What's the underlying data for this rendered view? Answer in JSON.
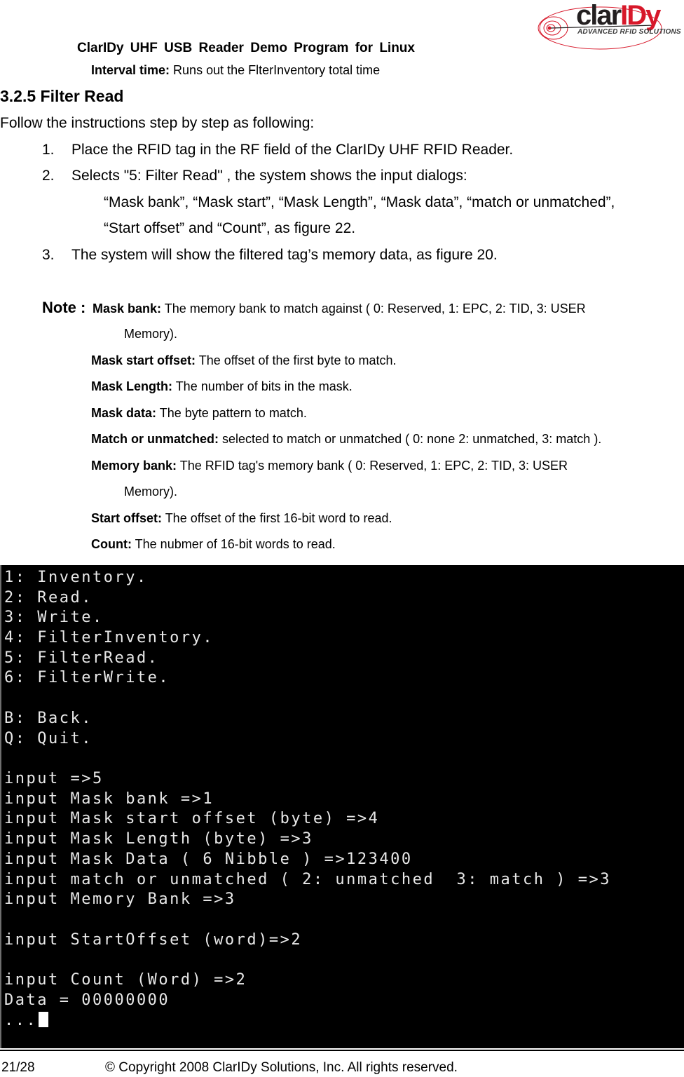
{
  "header": {
    "logo": {
      "brand_dark": "clar",
      "brand_red": "IDy",
      "tagline": "ADVANCED RFID SOLUTIONS",
      "brand_color": "#d7182a"
    },
    "doc_title": "ClarIDy UHF USB Reader Demo Program for Linux"
  },
  "interval": {
    "label": "Interval time:",
    "text": " Runs out the FlterInventory total time"
  },
  "section": {
    "heading": "3.2.5 Filter Read",
    "intro": "Follow the instructions step by step as following:",
    "steps": [
      {
        "num": "1.",
        "text": "Place the RFID tag in the RF field of the ClarIDy UHF RFID Reader."
      },
      {
        "num": "2.",
        "text": "Selects \"5: Filter Read\" , the system shows the input dialogs:",
        "continuation": [
          "“Mask bank”, “Mask start”, “Mask Length”, “Mask data”, “match or unmatched”,",
          "“Start offset” and “Count”, as figure 22."
        ]
      },
      {
        "num": "3.",
        "text": "The system will show the filtered tag’s memory data, as figure 20."
      }
    ]
  },
  "note": {
    "label": "Note :",
    "items": [
      {
        "term": "Mask bank:",
        "desc": " The memory bank to match against ( 0: Reserved, 1: EPC, 2: TID, 3: USER",
        "cont": "Memory)."
      },
      {
        "term": "Mask start offset:",
        "desc": " The offset of the first byte to match."
      },
      {
        "term": "Mask Length:",
        "desc": " The number of bits in the mask."
      },
      {
        "term": "Mask data:",
        "desc": " The byte pattern to match."
      },
      {
        "term": "Match or unmatched:",
        "desc": " selected to match or unmatched ( 0: none 2: unmatched, 3: match )."
      },
      {
        "term": "Memory bank:",
        "desc": " The RFID tag's memory bank ( 0: Reserved, 1: EPC, 2: TID, 3: USER",
        "cont": "Memory)."
      },
      {
        "term": "Start offset:",
        "desc": " The offset of the first 16-bit word to read."
      },
      {
        "term": "Count:",
        "desc": " The nubmer of 16-bit words to read."
      }
    ]
  },
  "terminal": {
    "lines": [
      "1: Inventory.",
      "2: Read.",
      "3: Write.",
      "4: FilterInventory.",
      "5: FilterRead.",
      "6: FilterWrite.",
      "",
      "B: Back.",
      "Q: Quit.",
      "",
      "input =>5",
      "input Mask bank =>1",
      "input Mask start offset (byte) =>4",
      "input Mask Length (byte) =>3",
      "input Mask Data ( 6 Nibble ) =>123400",
      "input match or unmatched ( 2: unmatched  3: match ) =>3",
      "input Memory Bank =>3",
      "",
      "input StartOffset (word)=>2",
      "",
      "input Count (Word) =>2",
      "Data = 00000000",
      "..."
    ]
  },
  "footer": {
    "page": "21/28",
    "copyright": "© Copyright 2008 ClarIDy Solutions, Inc. All rights reserved."
  }
}
